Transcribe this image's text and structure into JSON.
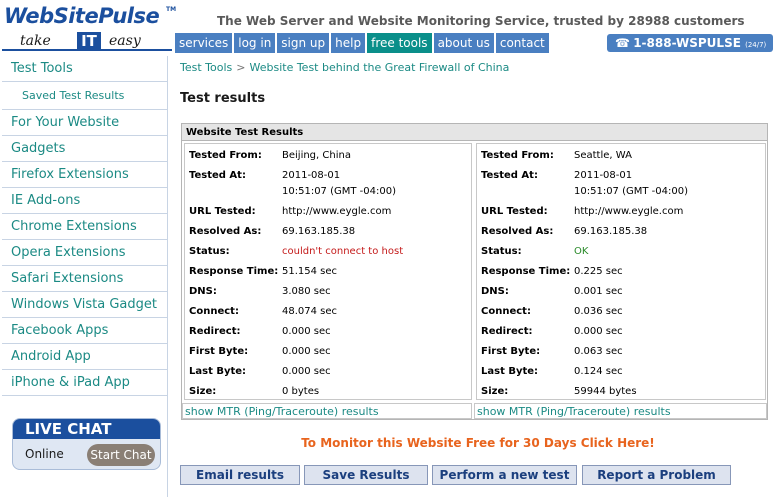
{
  "brand": {
    "logo": "WebSitePulse",
    "tm": "TM",
    "tagline_take": "take",
    "tagline_it": "IT",
    "tagline_easy": "easy"
  },
  "header": {
    "headline": "The Web Server and Website Monitoring Service, trusted by 28988 customers",
    "phone": "1-888-WSPULSE",
    "phone_hours": "(24/7)"
  },
  "nav": [
    "services",
    "log in",
    "sign up",
    "help",
    "free tools",
    "about us",
    "contact"
  ],
  "sidebar": {
    "items": [
      "Test Tools",
      "Saved Test Results",
      "For Your Website",
      "Gadgets",
      "Firefox Extensions",
      "IE Add-ons",
      "Chrome Extensions",
      "Opera Extensions",
      "Safari Extensions",
      "Windows Vista Gadget",
      "Facebook Apps",
      "Android App",
      "iPhone & iPad App"
    ],
    "livechat": {
      "title": "LIVE CHAT",
      "status": "Online",
      "button": "Start Chat"
    }
  },
  "breadcrumb": {
    "root": "Test Tools",
    "sep": ">",
    "current": "Website Test behind the Great Firewall of China"
  },
  "page_title": "Test results",
  "results": {
    "heading": "Website Test Results",
    "labels": {
      "tested_from": "Tested From:",
      "tested_at": "Tested At:",
      "url": "URL Tested:",
      "resolved": "Resolved As:",
      "status": "Status:",
      "response": "Response Time:",
      "dns": "DNS:",
      "connect": "Connect:",
      "redirect": "Redirect:",
      "first_byte": "First Byte:",
      "last_byte": "Last Byte:",
      "size": "Size:"
    },
    "a": {
      "tested_from": "Beijing, China",
      "tested_at_date": "2011-08-01",
      "tested_at_time": "10:51:07 (GMT -04:00)",
      "url": "http://www.eygle.com",
      "resolved": "69.163.185.38",
      "status": "couldn't connect to host",
      "response": "51.154 sec",
      "dns": "3.080 sec",
      "connect": "48.074 sec",
      "redirect": "0.000 sec",
      "first_byte": "0.000 sec",
      "last_byte": "0.000 sec",
      "size": "0 bytes",
      "mtr": "show MTR (Ping/Traceroute) results"
    },
    "b": {
      "tested_from": "Seattle, WA",
      "tested_at_date": "2011-08-01",
      "tested_at_time": "10:51:07 (GMT -04:00)",
      "url": "http://www.eygle.com",
      "resolved": "69.163.185.38",
      "status": "OK",
      "response": "0.225 sec",
      "dns": "0.001 sec",
      "connect": "0.036 sec",
      "redirect": "0.000 sec",
      "first_byte": "0.063 sec",
      "last_byte": "0.124 sec",
      "size": "59944 bytes",
      "mtr": "show MTR (Ping/Traceroute) results"
    }
  },
  "monitor_cta": "To Monitor this Website Free for 30 Days Click Here!",
  "buttons": {
    "email": "Email results",
    "save": "Save Results",
    "new_test": "Perform a new test",
    "report": "Report a Problem"
  },
  "colors": {
    "brand_blue": "#1b4f9e",
    "nav_blue": "#4a7fc1",
    "nav_active": "#0a8f8a",
    "link_teal": "#1b8a84",
    "error_red": "#c41a1a",
    "ok_green": "#2a8a2a",
    "cta_orange": "#e8641e"
  },
  "icons": {
    "phone": "phone-icon"
  }
}
